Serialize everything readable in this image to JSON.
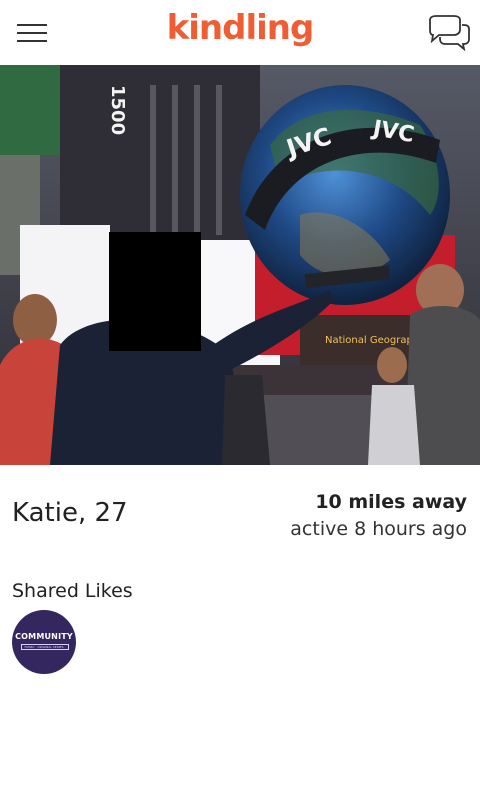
{
  "app": {
    "logo_text": "kindling"
  },
  "header": {
    "menu_icon": "hamburger-icon",
    "chat_icon": "chat-bubbles-icon"
  },
  "profile": {
    "name_age": "Katie, 27",
    "distance": "10 miles away",
    "last_active": "active 8 hours ago",
    "photo_sign_text": "JVC"
  },
  "shared_likes": {
    "title": "Shared Likes",
    "items": [
      {
        "label": "COMMUNITY",
        "sub": "FAMILY · ORIGINAL SERIES"
      }
    ]
  },
  "colors": {
    "brand": "#ef5d34",
    "badge": "#34275f"
  }
}
